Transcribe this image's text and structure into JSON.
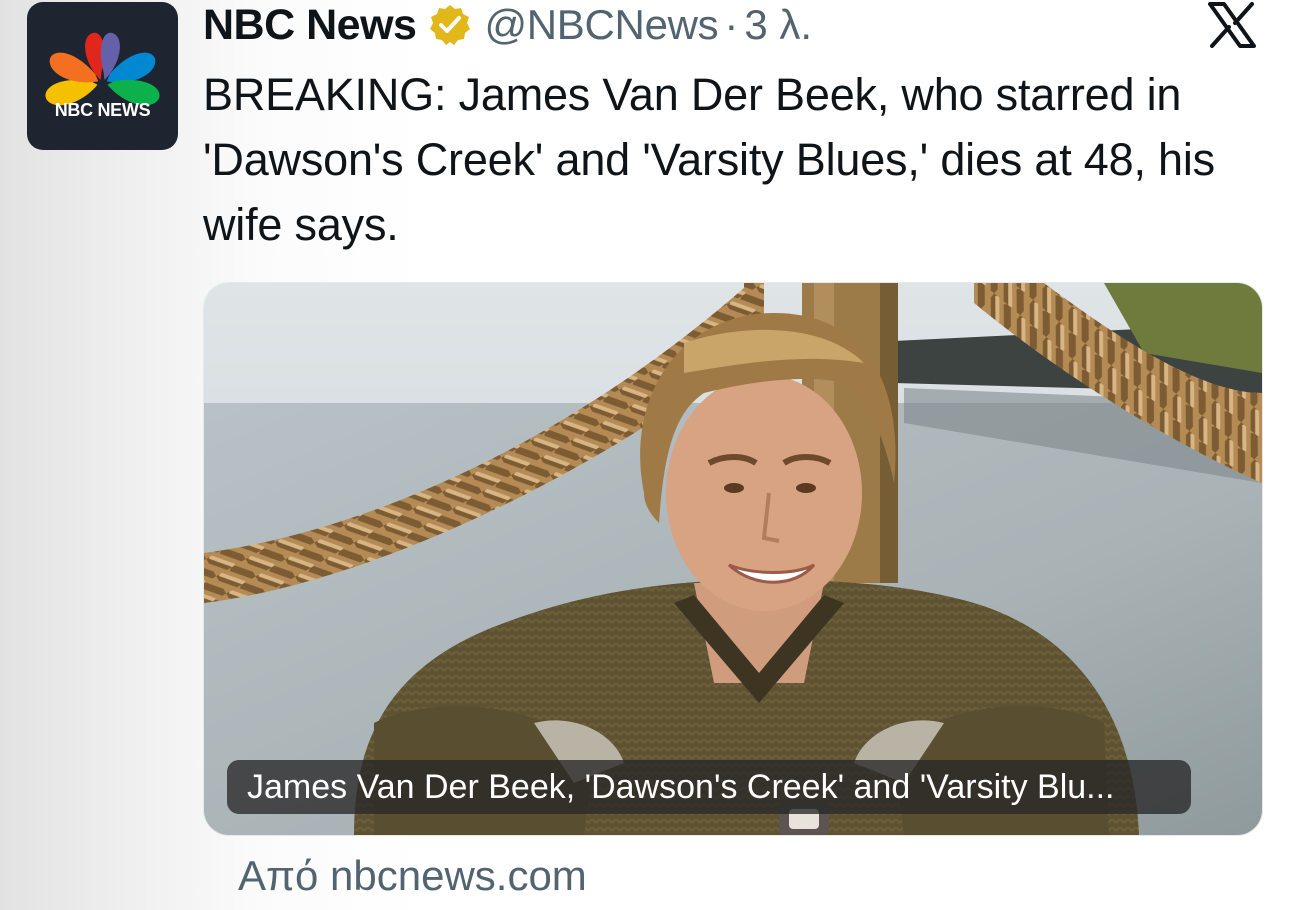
{
  "tweet": {
    "display_name": "NBC News",
    "handle": "@NBCNews",
    "separator": "·",
    "time": "3 λ.",
    "text": "BREAKING: James Van Der Beek, who starred in 'Dawson's Creek' and 'Varsity Blues,' dies at 48, his wife says.",
    "verified_badge_color": "#e2b719"
  },
  "avatar": {
    "label": "NBC NEWS",
    "background": "#1e2430"
  },
  "card": {
    "caption": "James Van Der Beek, 'Dawson's Creek' and 'Varsity Blu...",
    "source": "Από nbcnews.com"
  },
  "icons": {
    "platform": "x-logo-icon",
    "verified": "verified-badge-icon",
    "brand": "peacock-logo-icon"
  }
}
